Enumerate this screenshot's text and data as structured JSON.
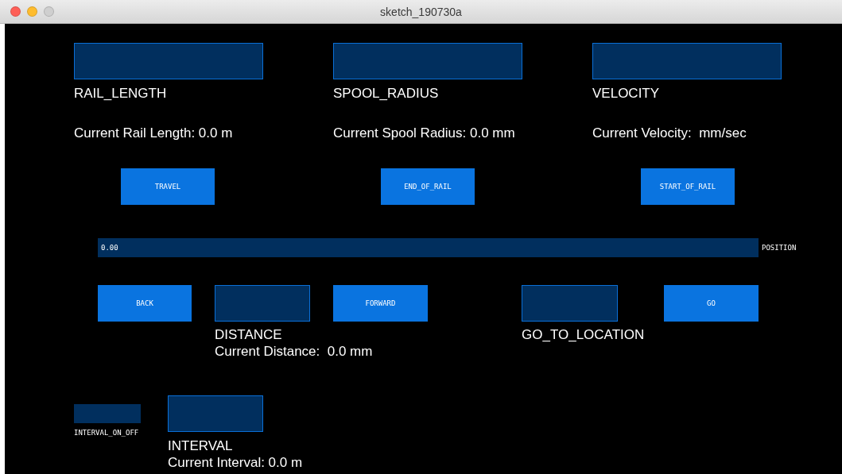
{
  "window": {
    "title": "sketch_190730a"
  },
  "settings": [
    {
      "label": "RAIL_LENGTH",
      "current": "Current Rail Length: 0.0 m"
    },
    {
      "label": "SPOOL_RADIUS",
      "current": "Current Spool Radius: 0.0 mm"
    },
    {
      "label": "VELOCITY",
      "current": "Current Velocity:  mm/sec"
    }
  ],
  "actions": [
    "TRAVEL",
    "END_OF_RAIL",
    "START_OF_RAIL"
  ],
  "position_slider": {
    "value": "0.00",
    "label": "POSITION"
  },
  "movement": {
    "back": "BACK",
    "forward": "FORWARD",
    "distance": {
      "label": "DISTANCE",
      "current": "Current Distance:  0.0 mm"
    },
    "go_to_location": {
      "label": "GO_TO_LOCATION"
    },
    "go": "GO"
  },
  "interval_toggle": {
    "label": "INTERVAL_ON_OFF",
    "on": false
  },
  "interval": {
    "label": "INTERVAL",
    "current": "Current Interval: 0.0 m"
  }
}
